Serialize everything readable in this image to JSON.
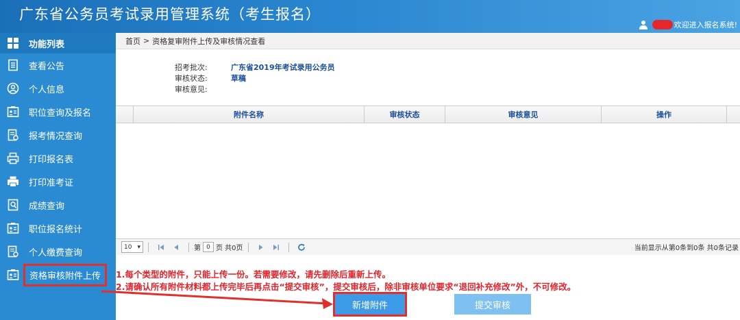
{
  "header": {
    "title": "广东省公务员考试录用管理系统（考生报名）",
    "welcome": "欢迎进入报名系统!"
  },
  "sidebar": {
    "heading": "功能列表",
    "items": [
      {
        "label": "查看公告",
        "icon": "document-list-icon"
      },
      {
        "label": "个人信息",
        "icon": "user-circle-icon"
      },
      {
        "label": "职位查询及报名",
        "icon": "id-card-icon"
      },
      {
        "label": "报考情况查询",
        "icon": "report-icon"
      },
      {
        "label": "打印报名表",
        "icon": "printer-icon"
      },
      {
        "label": "打印准考证",
        "icon": "printer-icon"
      },
      {
        "label": "成绩查询",
        "icon": "score-icon"
      },
      {
        "label": "职位报名统计",
        "icon": "id-card-icon"
      },
      {
        "label": "个人缴费查询",
        "icon": "report-icon"
      },
      {
        "label": "资格审核附件上传",
        "icon": "id-card-icon"
      }
    ]
  },
  "breadcrumb": {
    "home": "首页",
    "separator": ">",
    "current": "资格复审附件上传及审核情况查看"
  },
  "info": {
    "batch_label": "招考批次:",
    "batch_value": "广东省2019年考试录用公务员",
    "status_label": "审核状态:",
    "status_value": "草稿",
    "opinion_label": "审核意见:",
    "opinion_value": ""
  },
  "table": {
    "columns": [
      "附件名称",
      "审核状态",
      "审核意见",
      "操作"
    ],
    "rows": []
  },
  "pager": {
    "page_size": "10",
    "page_prefix": "第",
    "page_value": "0",
    "page_suffix": "页 共0页",
    "summary": "当前显示从第0条到0条 共0条记录"
  },
  "notes": [
    "1.每个类型的附件，只能上传一份。若需要修改，请先删除后重新上传。",
    "2.请确认所有附件材料都上传完毕后再点击“提交审核”，提交审核后，除非审核单位要求“退回补充修改”外，不可修改。"
  ],
  "buttons": {
    "add": "新增附件",
    "submit": "提交审核"
  },
  "colors": {
    "header_blue": "#2a86d0",
    "sidebar_blue": "#2a8bd2",
    "highlight_red": "#e0302c",
    "note_red": "#e0242b"
  }
}
